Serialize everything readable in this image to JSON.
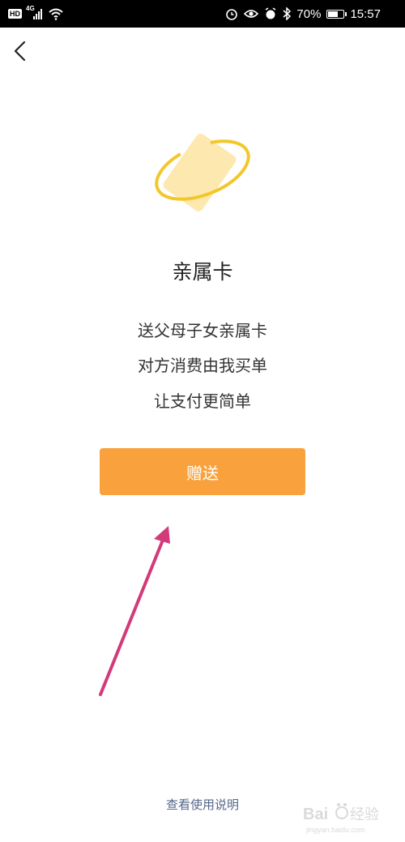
{
  "status_bar": {
    "hd": "HD",
    "network": "4G",
    "battery_percent": "70%",
    "battery_level": 0.7,
    "time": "15:57"
  },
  "icons": {
    "back": "chevron-left-icon",
    "card": "card-orbit-icon"
  },
  "main": {
    "title": "亲属卡",
    "description_lines": [
      "送父母子女亲属卡",
      "对方消费由我买单",
      "让支付更简单"
    ],
    "gift_button_label": "赠送",
    "help_link": "查看使用说明"
  },
  "colors": {
    "button": "#f9a23d",
    "card_fill": "#fde8b0",
    "orbit": "#f3c72a",
    "annotation_arrow": "#d23a7a",
    "link": "#56678a"
  }
}
